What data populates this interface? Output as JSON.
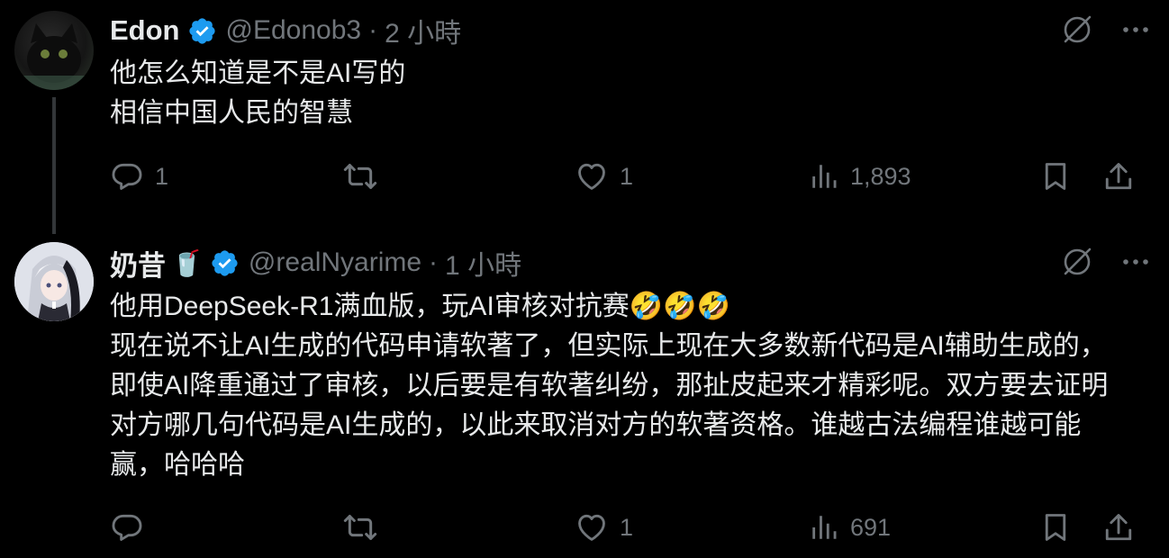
{
  "tweets": [
    {
      "author": {
        "name": "Edon",
        "handle": "@Edonob3",
        "name_emoji": ""
      },
      "separator": "·",
      "time": "2 小時",
      "text": "他怎么知道是不是AI写的\n相信中国人民的智慧",
      "stats": {
        "replies": "1",
        "reposts": "",
        "likes": "1",
        "views": "1,893"
      }
    },
    {
      "author": {
        "name": "奶昔",
        "handle": "@realNyarime",
        "name_emoji": "🥤"
      },
      "separator": "·",
      "time": "1 小時",
      "text": "他用DeepSeek-R1满血版，玩AI审核对抗赛🤣🤣🤣\n现在说不让AI生成的代码申请软著了，但实际上现在大多数新代码是AI辅助生成的，即使AI降重通过了审核，以后要是有软著纠纷，那扯皮起来才精彩呢。双方要去证明对方哪几句代码是AI生成的，以此来取消对方的软著资格。谁越古法编程谁越可能赢，哈哈哈",
      "stats": {
        "replies": "",
        "reposts": "",
        "likes": "1",
        "views": "691"
      }
    }
  ],
  "colors": {
    "background": "#000000",
    "text": "#e7e9ea",
    "muted": "#71767b",
    "verified": "#1d9bf0",
    "thread_line": "#333639"
  },
  "icons": [
    "verified-badge-icon",
    "grok-icon",
    "more-icon",
    "reply-icon",
    "repost-icon",
    "like-icon",
    "views-icon",
    "bookmark-icon",
    "share-icon"
  ]
}
